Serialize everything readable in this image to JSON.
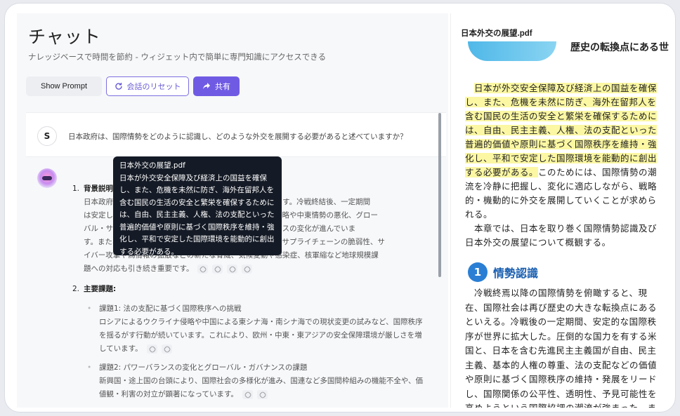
{
  "header": {
    "title": "チャット",
    "subtitle": "ナレッジベースで時間を節約 - ウィジェット内で簡単に専門知識にアクセスできる"
  },
  "toolbar": {
    "show_prompt": "Show Prompt",
    "reset": "会話のリセット",
    "share": "共有"
  },
  "user_message": {
    "avatar": "S",
    "text": "日本政府は、国際情勢をどのように認識し、どのような外交を展開する必要があると述べていますか？"
  },
  "answer": {
    "section1": {
      "num": "1.",
      "title": "背景説明:",
      "lines": [
        "日本政府は、国際情勢が歴史の転換点にあると認識しています。冷戦終結後、一定期間",
        "は安定した国際秩序が維持されてきましたが、ウクライナ侵略や中東情勢の悪化、グロー",
        "バル・サウスの台頭など、国際社会の多様化とパワーバランスの変化が進んでいま",
        "す。また、経済安全保障分野での強制を含む経済的な威圧やサプライチェーンの脆弱性、サ",
        "イバー攻撃や偽情報の拡散などの新たな脅威、気候変動や感染症、核軍縮など地球規模課",
        "題への対応も引き続き重要です。"
      ]
    },
    "section2": {
      "num": "2.",
      "title": "主要課題:",
      "items": [
        {
          "title": "課題1: 法の支配に基づく国際秩序への挑戦",
          "lines": [
            "ロシアによるウクライナ侵略や中国による東シナ海・南シナ海での現状変更の試みなど、国際秩序",
            "を揺るがす行動が続いています。これにより、欧州・中東・東アジアの安全保障環境が厳しさを増",
            "しています。"
          ]
        },
        {
          "title": "課題2: パワーバランスの変化とグローバル・ガバナンスの課題",
          "lines": [
            "新興国・途上国の台頭により、国際社会の多様化が進み、国連など多国間枠組みの機能不全や、価",
            "値観・利害の対立が顕著になっています。"
          ]
        }
      ]
    }
  },
  "tooltip": {
    "title": "日本外交の展望.pdf",
    "lines": [
      "日本が外交安全保障及び経済上の国益を確保",
      "し、また、危機を未然に防ぎ、海外在留邦人を",
      "含む国民の生活の安全と繁栄を確保するために",
      "は、自由、民主主義、人権、法の支配といった",
      "普遍的価値や原則に基づく国際秩序を維持・強",
      "化し、平和で安定した国際環境を能動的に創出",
      "する必要がある。"
    ]
  },
  "pdf": {
    "title": "日本外交の展望.pdf",
    "banner_text": "歴史の転換点にある世",
    "highlighted_lines": [
      "日本が外交安全保障及び経済上の国益を確保",
      "し、また、危機を未然に防ぎ、海外在留邦人を",
      "含む国民の生活の安全と繁栄を確保するために",
      "は、自由、民主主義、人権、法の支配といった",
      "普遍的価値や原則に基づく国際秩序を維持・強",
      "化し、平和で安定した国際環境を能動的に創出",
      "する必要がある。"
    ],
    "continuation": "このためには、国際情勢の潮",
    "lines_after": [
      "流を冷静に把握し、変化に適応しながら、戦略",
      "的・機動的に外交を展開していくことが求めら",
      "れる。",
      "本章では、日本を取り巻く国際情勢認識及び",
      "日本外交の展望について概観する。"
    ],
    "section_num": "1",
    "section_title": "情勢認識",
    "section_lines": [
      "冷戦終焉以降の国際情勢を俯瞰すると、現",
      "在、国際社会は再び歴史の大きな転換点にある",
      "といえる。冷戦後の一定期間、安定的な国際秩",
      "序が世界に拡大した。圧倒的な国力を有する米",
      "国と、日本を含む先進民主主義国が自由、民主",
      "主義、基本的人権の尊重、法の支配などの価値",
      "や原則に基づく国際秩序の維持・発展をリード",
      "し、国際関係の公平性、透明性、予見可能性を",
      "高めようという国際協調の潮流が強まった。ま"
    ]
  },
  "colors": {
    "accent": "#6f5be3",
    "highlight": "#fbf7a3",
    "tooltip_bg": "#151b26",
    "pdf_heading": "#2a7fd4"
  }
}
